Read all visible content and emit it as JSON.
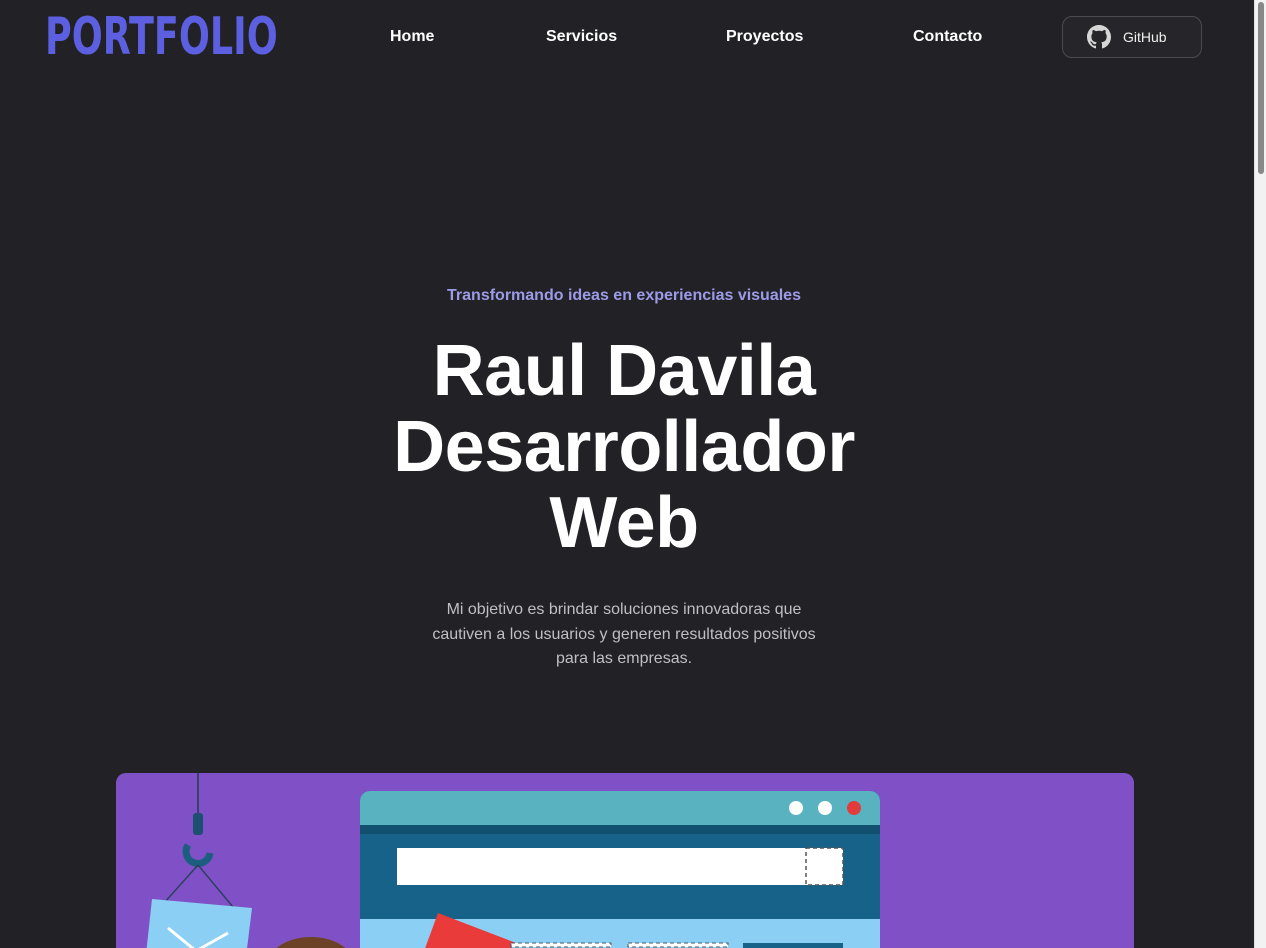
{
  "nav": {
    "logo": "PORTFOLIO",
    "links": [
      "Home",
      "Servicios",
      "Proyectos",
      "Contacto"
    ],
    "github_label": "GitHub"
  },
  "hero": {
    "tagline": "Transformando ideas en experiencias visuales",
    "title_lines": [
      "Raul Davila",
      "Desarrollador",
      "Web"
    ],
    "description": "Mi objetivo es brindar soluciones innovadoras que cautiven a los usuarios y generen resultados positivos para las empresas."
  },
  "colors": {
    "background": "#222226",
    "accent": "#5b5fe0",
    "tagline": "#9d9ae8",
    "illustration_bg": "#8051c6"
  },
  "icons": {
    "github": "github-icon"
  }
}
